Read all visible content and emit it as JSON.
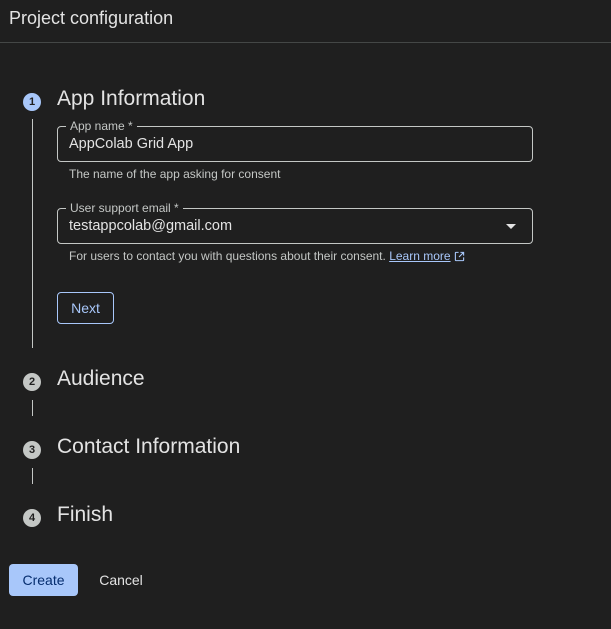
{
  "header": {
    "title": "Project configuration"
  },
  "steps": [
    {
      "number": "1",
      "title": "App Information"
    },
    {
      "number": "2",
      "title": "Audience"
    },
    {
      "number": "3",
      "title": "Contact Information"
    },
    {
      "number": "4",
      "title": "Finish"
    }
  ],
  "app_info": {
    "app_name": {
      "label": "App name *",
      "value": "AppColab Grid App",
      "helper": "The name of the app asking for consent"
    },
    "support_email": {
      "label": "User support email *",
      "value": "testappcolab@gmail.com",
      "helper": "For users to contact you with questions about their consent.",
      "learn_more": "Learn more"
    },
    "next_label": "Next"
  },
  "actions": {
    "create_label": "Create",
    "cancel_label": "Cancel"
  },
  "colors": {
    "accent": "#a8c7fa",
    "background": "#1f1f1f",
    "text": "#e3e3e3"
  },
  "icons": {
    "external_link": "open-in-new-icon",
    "dropdown": "arrow-drop-down-icon"
  }
}
